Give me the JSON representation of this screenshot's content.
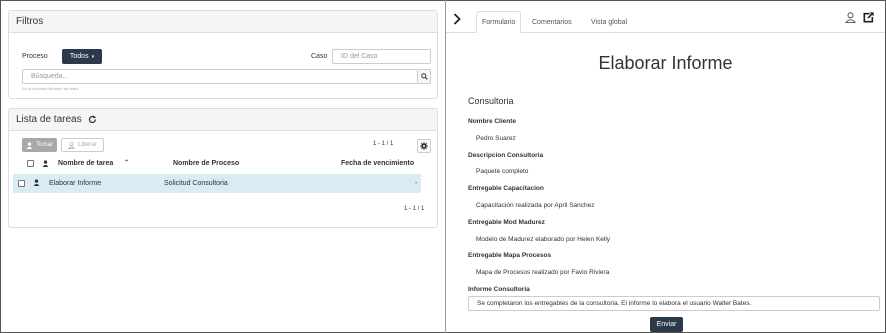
{
  "filters": {
    "title": "Filtros",
    "process_label": "Proceso",
    "process_value": "Todos",
    "case_label": "Caso",
    "case_placeholder": "ID del Caso",
    "search_placeholder": "Búsqueda...",
    "search_hint": "En la columna Nombre de tarea"
  },
  "tasks": {
    "title": "Lista de tareas",
    "take_label": "Tomar",
    "release_label": "Liberar",
    "pager_top": "1 - 1 / 1",
    "pager_bottom": "1 - 1 / 1",
    "columns": [
      "Nombre de tarea",
      "Nombre de Proceso",
      "Fecha de vencimiento"
    ],
    "rows": [
      {
        "task": "Elaborar Informe",
        "process": "Solicitud Consultoria",
        "due": "-"
      }
    ]
  },
  "detail": {
    "tabs": [
      "Formulario",
      "Comentarios",
      "Vista global"
    ],
    "title": "Elaborar Informe",
    "section": "Consultoria",
    "fields": [
      {
        "label": "Nombre Cliente",
        "value": "Pedro Suarez"
      },
      {
        "label": "Descripcion Consultoria",
        "value": "Paquete completo"
      },
      {
        "label": "Entregable Capacitacion",
        "value": "Capacitación realizada por April Sanchez"
      },
      {
        "label": "Entregable Mod Madurez",
        "value": "Modelo de Madurez elaborado por Helen Kelly"
      },
      {
        "label": "Entregable Mapa Procesos",
        "value": "Mapa de Procesos realizado por Favio Riviera"
      }
    ],
    "report_label": "Informe Consultoria",
    "report_value": "Se completaron los entregables de la consultoria. El informe lo elabora el usuario Walter Bates.",
    "submit_label": "Enviar"
  },
  "icons": {
    "refresh": "refresh-icon",
    "gear": "gear-icon",
    "user": "user-icon",
    "search": "search-icon",
    "chevron": "chevron-right-icon",
    "open": "external-link-icon"
  },
  "colors": {
    "primary_button": "#2b3a4a",
    "selected_row": "#d9ebf3"
  }
}
